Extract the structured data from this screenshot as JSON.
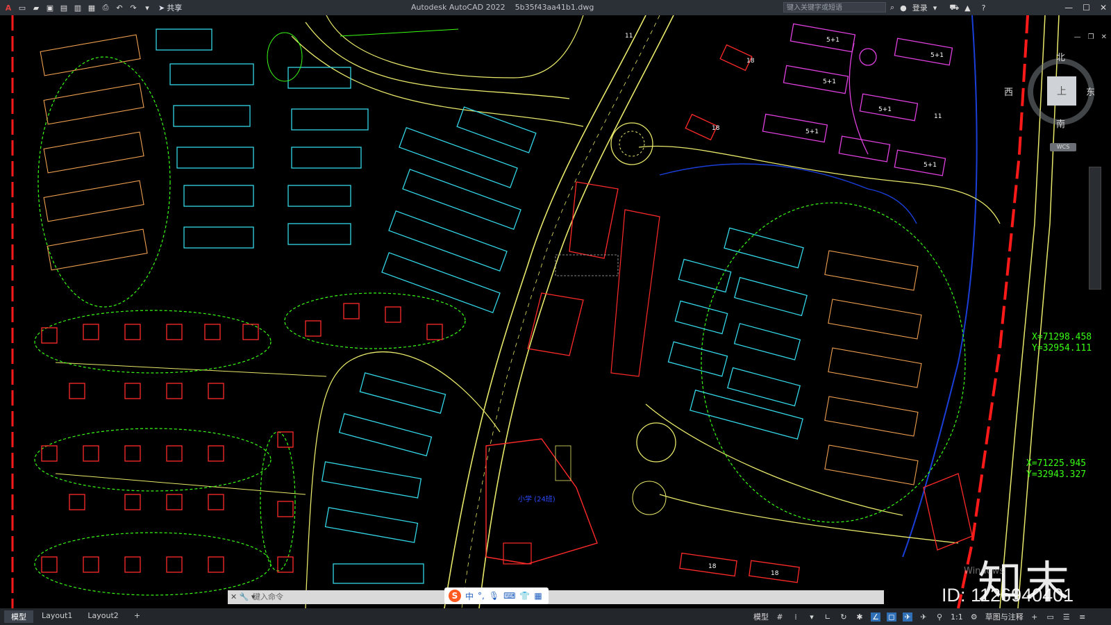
{
  "app": {
    "title": "Autodesk AutoCAD 2022",
    "filename": "5b35f43aa41b1.dwg"
  },
  "toolbar": {
    "share_label": "共享",
    "search_placeholder": "键入关键字或短语",
    "login_label": "登录"
  },
  "viewcube": {
    "north": "北",
    "south": "南",
    "west": "西",
    "east": "东",
    "face": "上",
    "wcs": "WCS"
  },
  "coordinates": [
    {
      "x": "X=71298.458",
      "y": "Y=32954.111"
    },
    {
      "x": "X=71225.945",
      "y": "Y=32943.327"
    }
  ],
  "drawing_labels": {
    "school": "小学 (24班)",
    "floors_5": "5+1",
    "floors_18": "18",
    "floors_11": "11"
  },
  "ime": {
    "lang": "中",
    "punct": "°,"
  },
  "command_line": {
    "placeholder": "键入命令"
  },
  "layout_tabs": [
    "模型",
    "Layout1",
    "Layout2"
  ],
  "status": {
    "model_label": "模型",
    "scale": "1:1",
    "workspace": "草图与注释"
  },
  "watermark": {
    "brand": "知末",
    "id_text": "ID: 1126940401",
    "activate": "Windows"
  },
  "colors": {
    "road": "#e8e86a",
    "greenery": "#39ff14",
    "building_cyan": "#33d6e6",
    "building_red": "#ff2a2a",
    "building_magenta": "#e040e0",
    "boundary": "#ff1a1a",
    "water": "#1a3fd9"
  }
}
